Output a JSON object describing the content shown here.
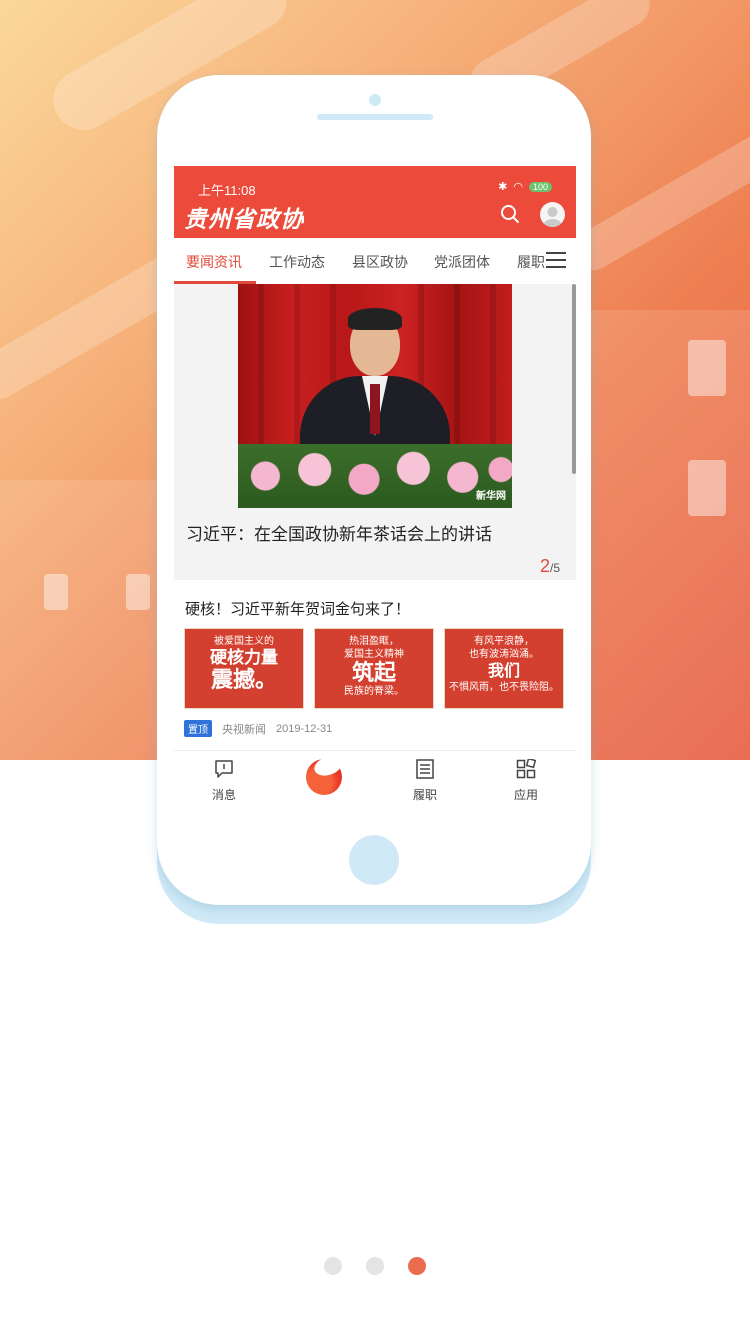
{
  "colors": {
    "brand_red": "#ec4a3a",
    "accent_tab": "#e14a3a",
    "pin_badge": "#2f73d8",
    "dot_active": "#ea6b4e"
  },
  "status_bar": {
    "time": "上午11:08",
    "battery": "100"
  },
  "header": {
    "app_title": "贵州省政协",
    "search_icon": "search-icon",
    "avatar_icon": "avatar-icon"
  },
  "tabs": [
    {
      "label": "要闻资讯",
      "active": true
    },
    {
      "label": "工作动态",
      "active": false
    },
    {
      "label": "县区政协",
      "active": false
    },
    {
      "label": "党派团体",
      "active": false
    },
    {
      "label": "履职",
      "active": false
    }
  ],
  "slider": {
    "watermark": "新华网",
    "caption": "习近平：在全国政协新年茶话会上的讲话",
    "current": "2",
    "total": "/5"
  },
  "article": {
    "title": "硬核！习近平新年贺词金句来了！",
    "thumbs": [
      {
        "line1": "被爱国主义的",
        "big": "硬核力量",
        "big2": "震撼。",
        "line2": ""
      },
      {
        "line1": "热泪盈眶，",
        "big": "爱国主义精神",
        "big2": "筑起",
        "line2": "民族的脊梁。"
      },
      {
        "line1": "有风平浪静，",
        "big": "也有波涛汹涌。",
        "big2": "我们",
        "line2": "不惧风雨，也不畏险阻。"
      }
    ],
    "badge": "置顶",
    "source": "央视新闻",
    "date": "2019-12-31"
  },
  "bottom_nav": [
    {
      "label": "消息",
      "icon": "message-icon"
    },
    {
      "label": "",
      "icon": "app-logo-icon"
    },
    {
      "label": "履职",
      "icon": "document-icon"
    },
    {
      "label": "应用",
      "icon": "apps-grid-icon"
    }
  ],
  "pagination": {
    "count": 3,
    "active_index": 2
  }
}
